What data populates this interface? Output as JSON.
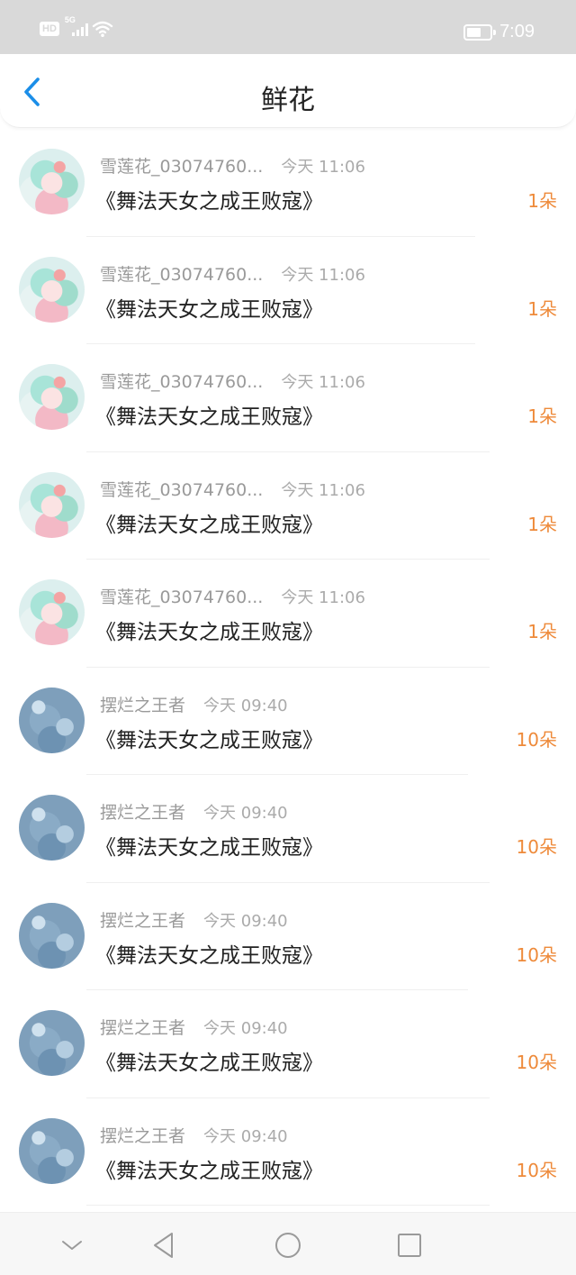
{
  "status_bar": {
    "hd_label": "HD",
    "network_label": "5G",
    "time": "7:09",
    "battery_percent": 55,
    "icons": [
      "signal-icon",
      "wifi-icon",
      "battery-icon"
    ]
  },
  "header": {
    "title": "鲜花",
    "back_icon": "chevron-left-icon",
    "accent_color": "#1b8ee8"
  },
  "items": [
    {
      "avatar": "girl",
      "user": "雪莲花_03074760...",
      "time": "今天 11:06",
      "work": "《舞法天女之成王败寇》",
      "count": "1朵"
    },
    {
      "avatar": "girl",
      "user": "雪莲花_03074760...",
      "time": "今天 11:06",
      "work": "《舞法天女之成王败寇》",
      "count": "1朵"
    },
    {
      "avatar": "girl",
      "user": "雪莲花_03074760...",
      "time": "今天 11:06",
      "work": "《舞法天女之成王败寇》",
      "count": "1朵"
    },
    {
      "avatar": "girl",
      "user": "雪莲花_03074760...",
      "time": "今天 11:06",
      "work": "《舞法天女之成王败寇》",
      "count": "1朵"
    },
    {
      "avatar": "girl",
      "user": "雪莲花_03074760...",
      "time": "今天 11:06",
      "work": "《舞法天女之成王败寇》",
      "count": "1朵"
    },
    {
      "avatar": "water",
      "user": "摆烂之王者",
      "time": "今天 09:40",
      "work": "《舞法天女之成王败寇》",
      "count": "10朵"
    },
    {
      "avatar": "water",
      "user": "摆烂之王者",
      "time": "今天 09:40",
      "work": "《舞法天女之成王败寇》",
      "count": "10朵"
    },
    {
      "avatar": "water",
      "user": "摆烂之王者",
      "time": "今天 09:40",
      "work": "《舞法天女之成王败寇》",
      "count": "10朵"
    },
    {
      "avatar": "water",
      "user": "摆烂之王者",
      "time": "今天 09:40",
      "work": "《舞法天女之成王败寇》",
      "count": "10朵"
    },
    {
      "avatar": "water",
      "user": "摆烂之王者",
      "time": "今天 09:40",
      "work": "《舞法天女之成王败寇》",
      "count": "10朵"
    }
  ],
  "count_color": "#ee8a3a",
  "nav_bar": {
    "icons": [
      "chevron-down-icon",
      "back-triangle-icon",
      "home-circle-icon",
      "recent-square-icon"
    ]
  }
}
